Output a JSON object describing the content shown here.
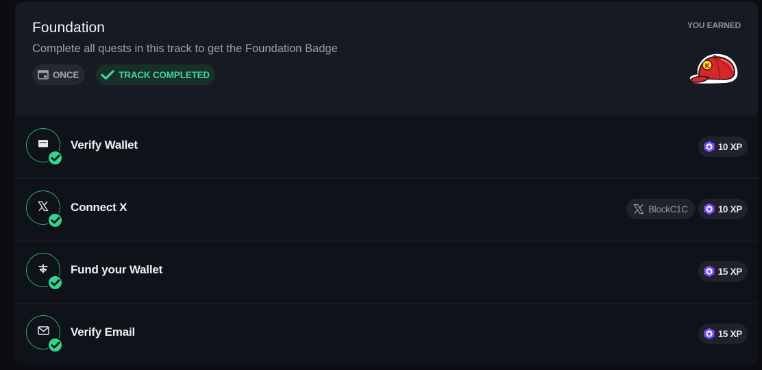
{
  "track": {
    "title": "Foundation",
    "subtitle": "Complete all quests in this track to get the Foundation Badge",
    "chips": {
      "frequency": "ONCE",
      "status": "TRACK COMPLETED"
    },
    "earned_label": "YOU EARNED",
    "badge_icon": "red-cap-badge"
  },
  "quests": [
    {
      "title": "Verify Wallet",
      "icon": "wallet-icon",
      "completed": true,
      "xp": "10 XP"
    },
    {
      "title": "Connect X",
      "icon": "x-logo-icon",
      "completed": true,
      "handle": "BlockC1C",
      "xp": "10 XP"
    },
    {
      "title": "Fund your Wallet",
      "icon": "fund-icon",
      "completed": true,
      "xp": "15 XP"
    },
    {
      "title": "Verify Email",
      "icon": "mail-icon",
      "completed": true,
      "xp": "15 XP"
    }
  ],
  "colors": {
    "accent_green": "#34d48f",
    "xp_purple": "#7b4dff",
    "badge_red": "#e0262b"
  }
}
